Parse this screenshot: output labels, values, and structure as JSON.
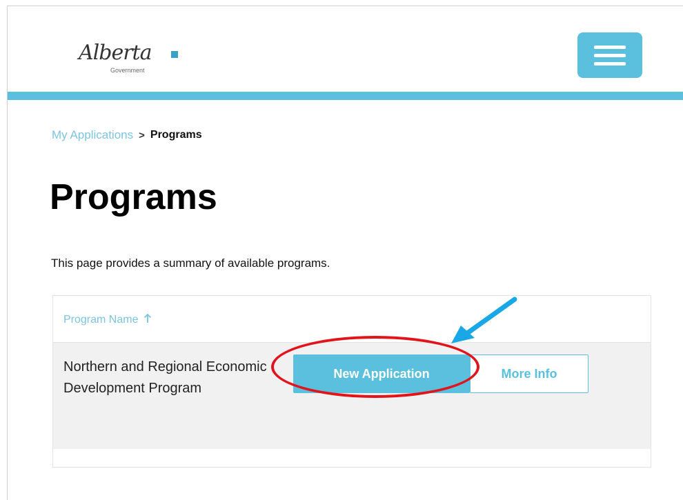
{
  "header": {
    "logo": {
      "name": "Alberta",
      "sub": "Government"
    },
    "menu_icon": "hamburger-menu-icon",
    "bar_color": "#5bc0de"
  },
  "breadcrumb": {
    "link_label": "My Applications",
    "separator": ">",
    "current_label": "Programs"
  },
  "page": {
    "title": "Programs",
    "description": "This page provides a summary of available programs."
  },
  "table": {
    "header_label": "Program Name",
    "sort_icon": "arrow-up-icon",
    "rows": [
      {
        "name": "Northern and Regional Economic Development Program",
        "new_application_label": "New Application",
        "more_info_label": "More Info"
      }
    ]
  },
  "annotations": {
    "ellipse_color": "#e2141b",
    "arrow_color": "#1aa7e8"
  }
}
